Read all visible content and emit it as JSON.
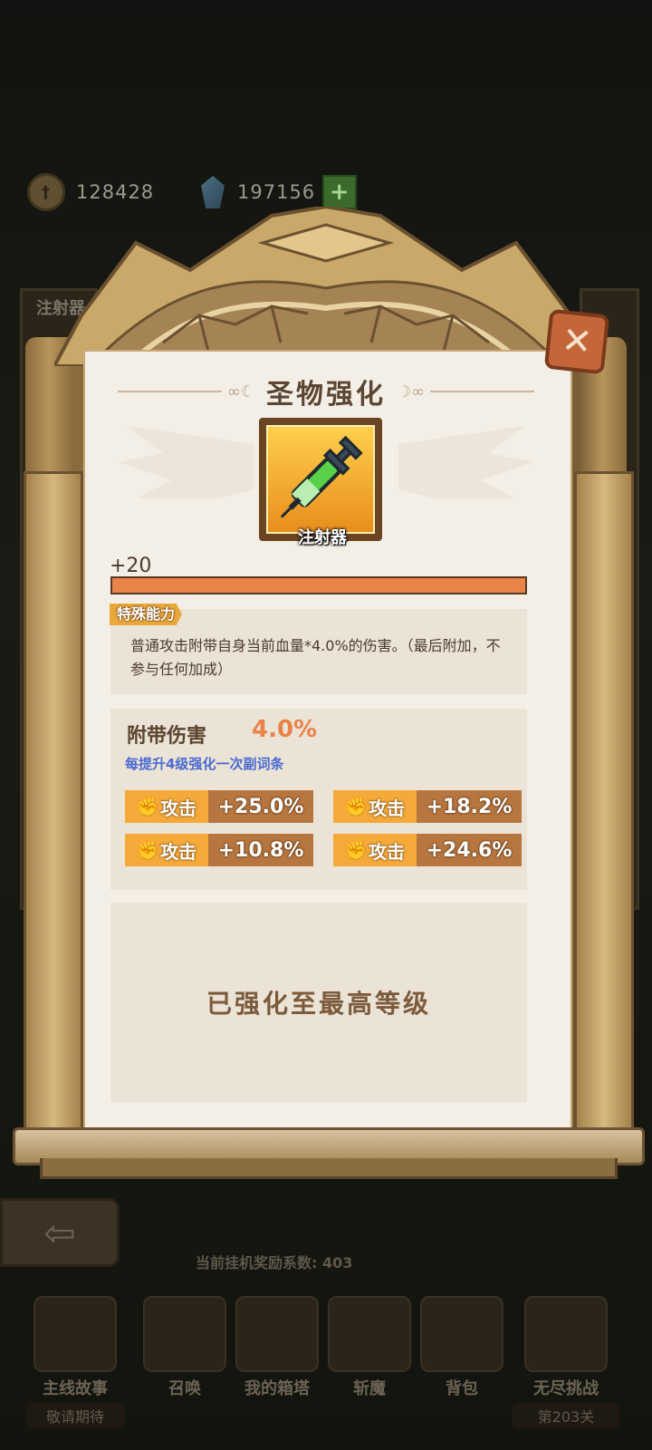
{
  "currency": {
    "coins": "128428",
    "gems": "197156"
  },
  "background": {
    "top_tab_1": "注射器",
    "bottom_center_text": "当前挂机奖励系数: 403",
    "nav_items": [
      {
        "label": "主线故事",
        "sub": "敬请期待"
      },
      {
        "label": "召唤",
        "sub": ""
      },
      {
        "label": "我的箱塔",
        "sub": ""
      },
      {
        "label": "斩魔",
        "sub": ""
      },
      {
        "label": "背包",
        "sub": ""
      },
      {
        "label": "无尽挑战",
        "sub": "第203关"
      }
    ]
  },
  "modal": {
    "title": "圣物强化",
    "item_name": "注射器",
    "level": "+20",
    "level_progress": 1.0,
    "ability_tag": "特殊能力",
    "ability_desc": "普通攻击附带自身当前血量*4.0%的伤害。（最后附加，不参与任何加成）",
    "damage_label": "附带伤害",
    "damage_value": "4.0%",
    "hint": "每提升4级强化一次副词条",
    "substats": [
      {
        "name": "攻击",
        "value": "+25.0%"
      },
      {
        "name": "攻击",
        "value": "+18.2%"
      },
      {
        "name": "攻击",
        "value": "+10.8%"
      },
      {
        "name": "攻击",
        "value": "+24.6%"
      }
    ],
    "max_text": "已强化至最高等级"
  },
  "colors": {
    "accent": "#e8834a",
    "stat_bg": "#f4a93a",
    "hint": "#4a6ad0"
  }
}
